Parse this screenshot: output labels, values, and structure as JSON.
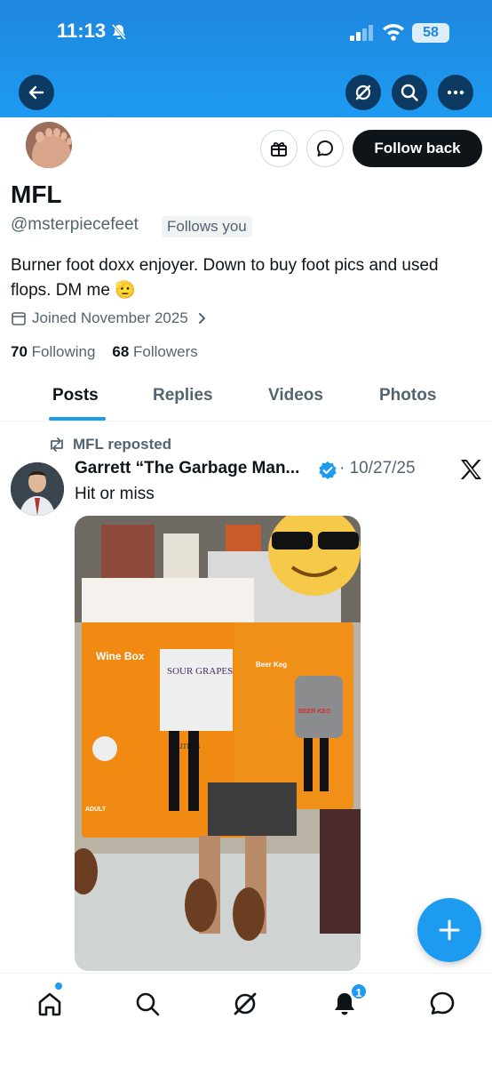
{
  "status_bar": {
    "time": "11:13",
    "battery": "58"
  },
  "profile": {
    "display_name": "MFL",
    "handle": "@msterpiecefeet",
    "follows_you": "Follows you",
    "bio": "Burner foot doxx enjoyer. Down to buy foot pics and used flops. DM me 🫡",
    "joined": "Joined November 2025",
    "following_count": "70",
    "following_label": "Following",
    "followers_count": "68",
    "followers_label": "Followers",
    "follow_back_label": "Follow back"
  },
  "tabs": [
    {
      "label": "Posts",
      "active": true
    },
    {
      "label": "Replies"
    },
    {
      "label": "Videos"
    },
    {
      "label": "Photos"
    }
  ],
  "post": {
    "reposted_by": "MFL reposted",
    "author": "Garrett “The Garbage Man...",
    "date": "· 10/27/25",
    "text": "Hit or miss",
    "media": {
      "costume_left_title": "Wine Box",
      "costume_left_product": "SOUR GRAPES",
      "costume_left_volume": "5 LITERS",
      "costume_right_title": "Beer Keg",
      "costume_right_product": "BEER KEG",
      "costume_left_age": "ADULT"
    }
  },
  "nav": {
    "notification_count": "1"
  },
  "colors": {
    "accent": "#1d9bf0",
    "banner": "#1f86de",
    "dark": "#0f1419"
  }
}
